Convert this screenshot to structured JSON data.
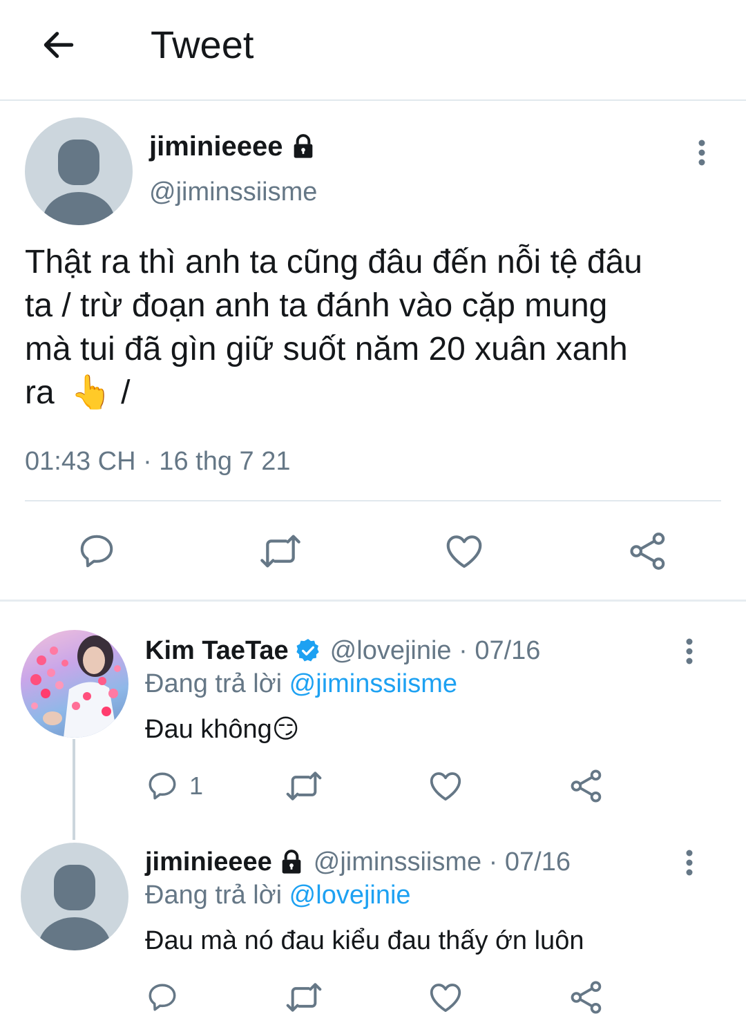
{
  "header": {
    "title": "Tweet"
  },
  "tweet": {
    "author_name": "jiminieeee",
    "author_handle": "@jiminssiisme",
    "protected": true,
    "text_line1": "Thật ra thì anh ta cũng đâu đến nỗi tệ đâu",
    "text_line2": "ta / trừ đoạn anh ta đánh vào cặp mung",
    "text_line3": "mà tui đã gìn giữ suốt năm 20 xuân xanh",
    "text_line4_start": "ra",
    "text_emoji": "👆",
    "text_line4_end": "/",
    "meta": "01:43 CH · 16 thg 7 21"
  },
  "replies": [
    {
      "name": "Kim TaeTae",
      "verified": true,
      "handle_date": "@lovejinie · 07/16",
      "replying_label": "Đang trả lời",
      "replying_to": "@jiminssiisme",
      "text": "Đau không",
      "emoji": "😏",
      "reply_count": "1"
    },
    {
      "name": "jiminieeee",
      "protected": true,
      "handle_date": "@jiminssiisme · 07/16",
      "replying_label": "Đang trả lời",
      "replying_to": "@lovejinie",
      "text": "Đau mà nó đau kiểu đau thấy ớn luôn"
    }
  ],
  "icons": {
    "back": "arrow-left-icon",
    "more": "more-vertical-icon",
    "reply": "reply-icon",
    "retweet": "retweet-icon",
    "like": "heart-icon",
    "share": "share-icon",
    "lock": "lock-icon",
    "verified": "verified-badge-icon"
  },
  "colors": {
    "accent": "#1da1f2",
    "secondary_text": "#657786",
    "icon_gray": "#657786",
    "divider": "#e1e8ed",
    "avatar_placeholder": "#ccd6dd",
    "avatar_silhouette": "#657786"
  }
}
